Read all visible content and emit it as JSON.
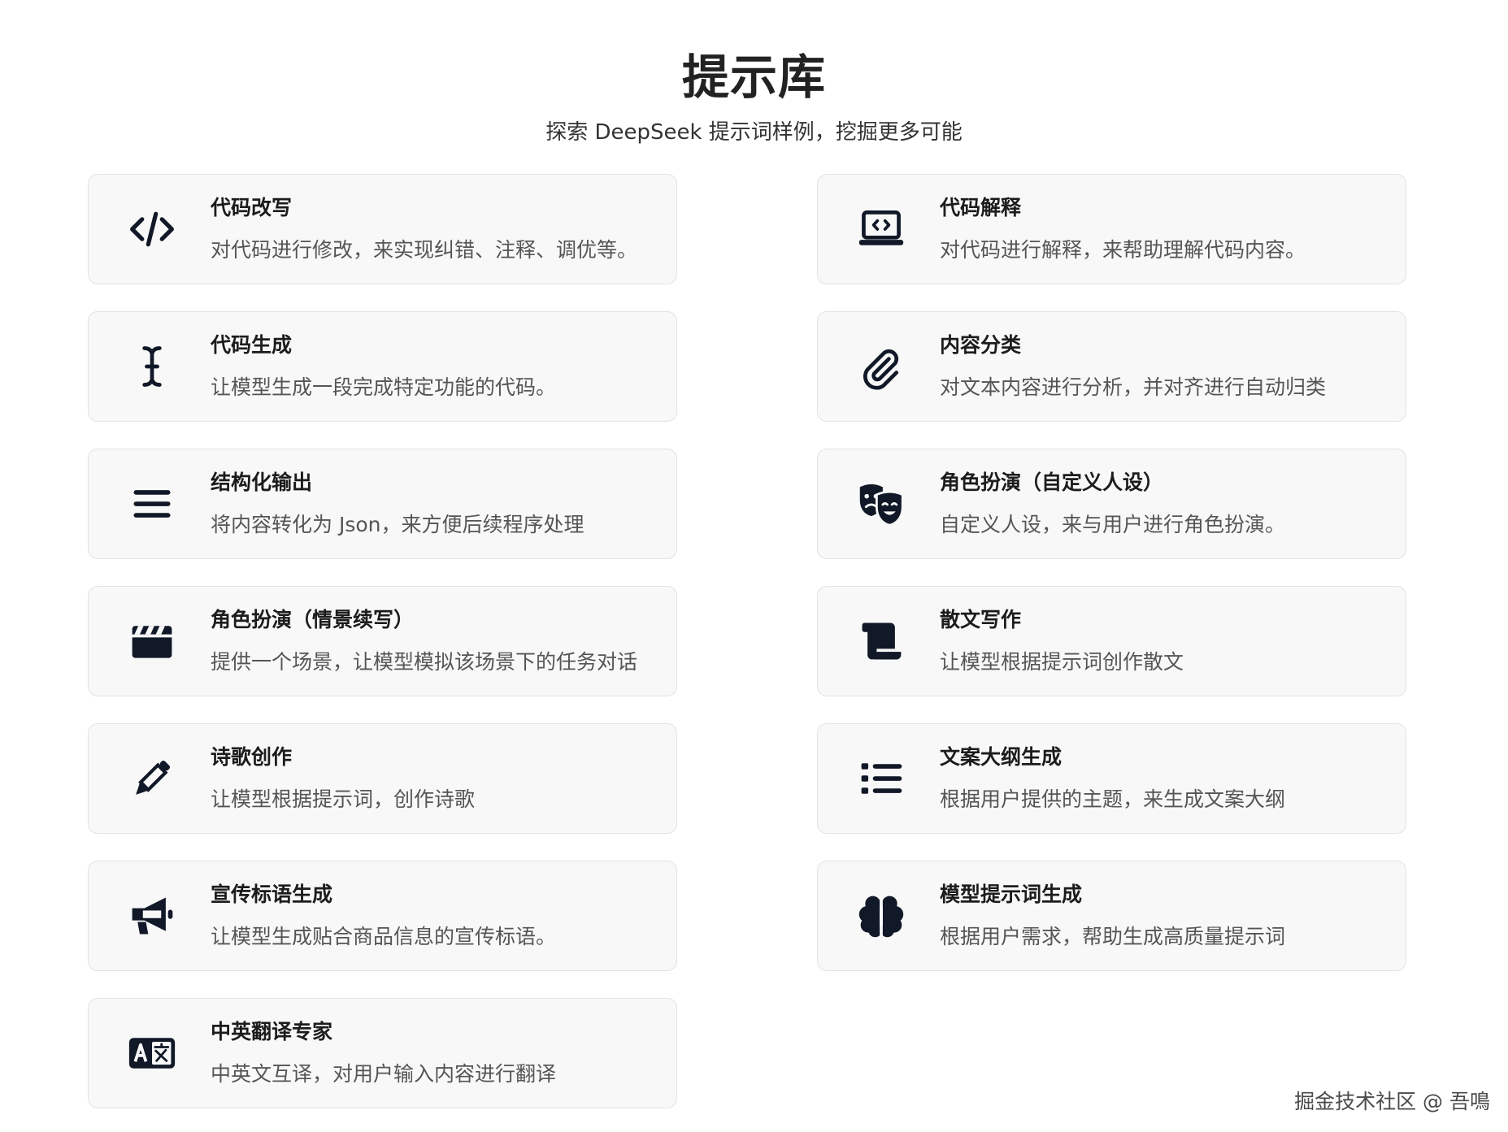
{
  "header": {
    "title": "提示库",
    "subtitle": "探索 DeepSeek 提示词样例，挖掘更多可能"
  },
  "cards": [
    {
      "title": "代码改写",
      "desc": "对代码进行修改，来实现纠错、注释、调优等。",
      "icon": "code-icon"
    },
    {
      "title": "代码解释",
      "desc": "对代码进行解释，来帮助理解代码内容。",
      "icon": "laptop-code-icon"
    },
    {
      "title": "代码生成",
      "desc": "让模型生成一段完成特定功能的代码。",
      "icon": "text-cursor-icon"
    },
    {
      "title": "内容分类",
      "desc": "对文本内容进行分析，并对齐进行自动归类",
      "icon": "paperclip-icon"
    },
    {
      "title": "结构化输出",
      "desc": "将内容转化为 Json，来方便后续程序处理",
      "icon": "bars-icon"
    },
    {
      "title": "角色扮演（自定义人设）",
      "desc": "自定义人设，来与用户进行角色扮演。",
      "icon": "masks-theater-icon"
    },
    {
      "title": "角色扮演（情景续写）",
      "desc": "提供一个场景，让模型模拟该场景下的任务对话",
      "icon": "clapperboard-icon"
    },
    {
      "title": "散文写作",
      "desc": "让模型根据提示词创作散文",
      "icon": "scroll-icon"
    },
    {
      "title": "诗歌创作",
      "desc": "让模型根据提示词，创作诗歌",
      "icon": "pencil-icon"
    },
    {
      "title": "文案大纲生成",
      "desc": "根据用户提供的主题，来生成文案大纲",
      "icon": "list-icon"
    },
    {
      "title": "宣传标语生成",
      "desc": "让模型生成贴合商品信息的宣传标语。",
      "icon": "bullhorn-icon"
    },
    {
      "title": "模型提示词生成",
      "desc": "根据用户需求，帮助生成高质量提示词",
      "icon": "brain-icon"
    },
    {
      "title": "中英翻译专家",
      "desc": "中英文互译，对用户输入内容进行翻译",
      "icon": "language-icon"
    }
  ],
  "watermark": "掘金技术社区 @ 吾鳴",
  "colors": {
    "background": "#ffffff",
    "card_background": "#f8f8f8",
    "card_border": "#e3e3e3",
    "icon": "#111827",
    "title_text": "#1c1c1c",
    "desc_text": "#555555"
  }
}
